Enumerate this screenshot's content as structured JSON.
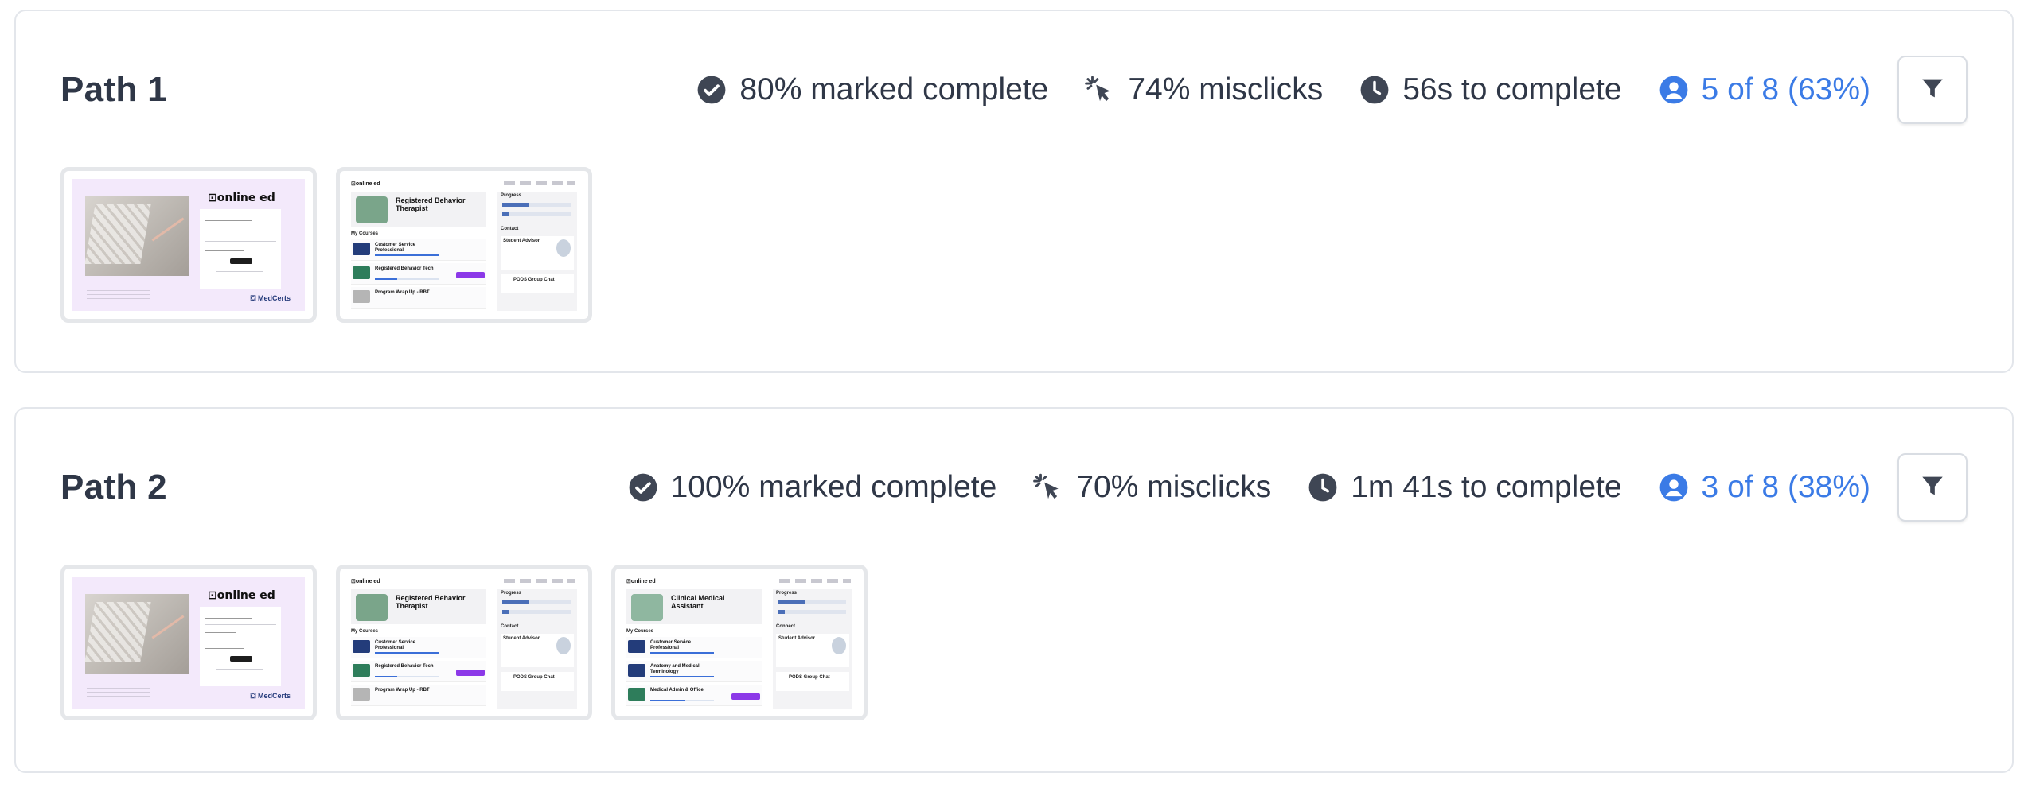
{
  "paths": [
    {
      "title": "Path 1",
      "marked_complete": "80% marked complete",
      "misclicks": "74% misclicks",
      "time": "56s to complete",
      "users": "5 of 8 (63%)",
      "screens": [
        {
          "type": "login",
          "logo": "online ed",
          "brand": "MedCerts"
        },
        {
          "type": "dashboard",
          "logo": "online ed",
          "hero": "Registered Behavior Therapist",
          "section": "My Courses",
          "side_progress": "Progress",
          "side_connect": "Contact",
          "advisor": "Student Advisor",
          "chat": "PODS Group Chat",
          "courses": [
            "Customer Service Professional",
            "Registered Behavior Tech",
            "Program Wrap Up - RBT"
          ]
        }
      ]
    },
    {
      "title": "Path 2",
      "marked_complete": "100% marked complete",
      "misclicks": "70% misclicks",
      "time": "1m 41s to complete",
      "users": "3 of 8 (38%)",
      "screens": [
        {
          "type": "login",
          "logo": "online ed",
          "brand": "MedCerts"
        },
        {
          "type": "dashboard",
          "logo": "online ed",
          "hero": "Registered Behavior Therapist",
          "section": "My Courses",
          "side_progress": "Progress",
          "side_connect": "Contact",
          "advisor": "Student Advisor",
          "chat": "PODS Group Chat",
          "courses": [
            "Customer Service Professional",
            "Registered Behavior Tech",
            "Program Wrap Up - RBT"
          ]
        },
        {
          "type": "dashboard",
          "logo": "online ed",
          "hero": "Clinical Medical Assistant",
          "section": "My Courses",
          "side_progress": "Progress",
          "side_connect": "Connect",
          "advisor": "Student Advisor",
          "chat": "PODS Group Chat",
          "courses": [
            "Customer Service Professional",
            "Anatomy and Medical Terminology",
            "Medical Admin & Office"
          ]
        }
      ]
    }
  ],
  "icons": {
    "complete": "check-circle-icon",
    "misclicks": "cursor-click-icon",
    "time": "clock-icon",
    "users": "user-circle-icon",
    "filter": "filter-icon"
  },
  "colors": {
    "text": "#2f3747",
    "icon": "#3f4654",
    "accent": "#3b7be6",
    "border": "#e3e6eb"
  }
}
